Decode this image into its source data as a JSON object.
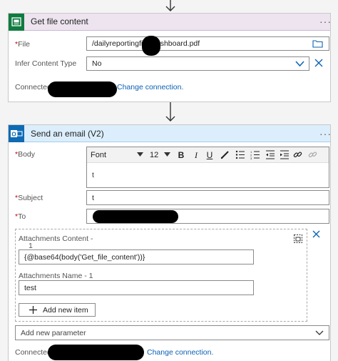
{
  "step1": {
    "title": "Get file content",
    "more": "···",
    "file_label": "File",
    "file_value": "/dailyreportingfile     Dashboard.pdf",
    "infer_label": "Infer Content Type",
    "infer_value": "No",
    "connected_prefix": "Connected t",
    "change_connection": "Change connection."
  },
  "step2": {
    "title": "Send an email (V2)",
    "more": "···",
    "body_label": "Body",
    "font_label": "Font",
    "font_size": "12",
    "bold": "B",
    "italic": "I",
    "underline": "U",
    "body_text": "t",
    "subject_label": "Subject",
    "subject_value": "t",
    "to_label": "To",
    "attachments_content_label": "Attachments Content -",
    "attachments_content_index": "1",
    "attachments_content_value": "{@base64(body('Get_file_content'))}",
    "attachments_name_label": "Attachments Name - 1",
    "attachments_name_value": "test",
    "add_item_label": "Add new item",
    "add_param_placeholder": "Add new parameter",
    "connected_prefix": "Connected t",
    "change_connection": "Change connection."
  },
  "colors": {
    "accent": "#0b61b5",
    "required": "#cc0000",
    "step1_header": "#ede4f0",
    "step2_header": "#dceefc",
    "sharepoint_green": "#0f7b3f",
    "outlook_blue": "#0f6ab4"
  },
  "icons": [
    "arrow-down-icon",
    "sharepoint-icon",
    "outlook-icon",
    "folder-icon",
    "chevron-down-icon",
    "close-icon",
    "pen-icon",
    "bullet-list-icon",
    "numbered-list-icon",
    "decrease-indent-icon",
    "increase-indent-icon",
    "link-icon",
    "unlink-icon",
    "plus-icon",
    "dynamic-content-icon"
  ]
}
